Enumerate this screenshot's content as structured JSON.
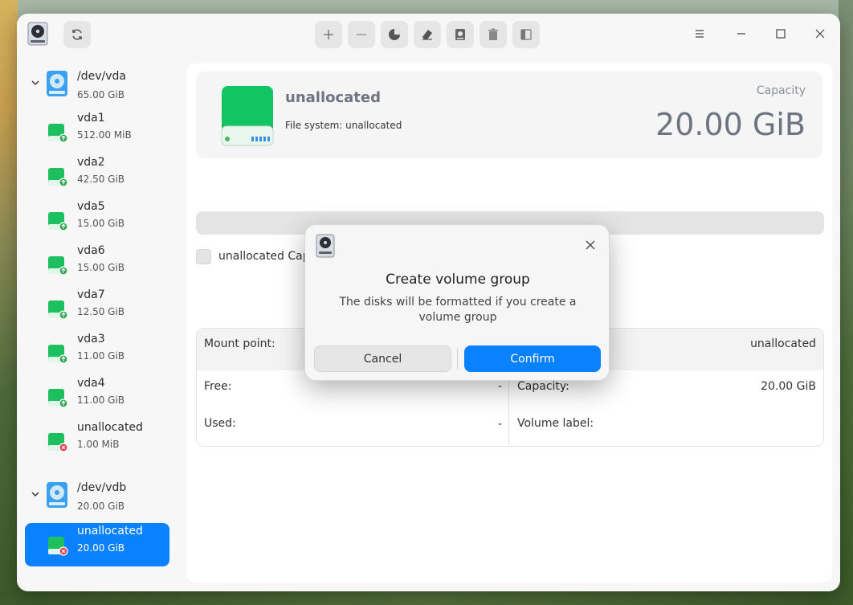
{
  "toolbar": {
    "refresh": "refresh-icon",
    "buttons": [
      "plus-icon",
      "minus-icon",
      "pie-chart-icon",
      "eraser-icon",
      "disk-info-icon",
      "delete-icon",
      "split-icon"
    ]
  },
  "sidebar": {
    "devices": [
      {
        "name": "/dev/vda",
        "size": "65.00 GiB",
        "partitions": [
          {
            "name": "vda1",
            "size": "512.00 MiB",
            "status": "mounted"
          },
          {
            "name": "vda2",
            "size": "42.50 GiB",
            "status": "mounted"
          },
          {
            "name": "vda5",
            "size": "15.00 GiB",
            "status": "mounted"
          },
          {
            "name": "vda6",
            "size": "15.00 GiB",
            "status": "mounted"
          },
          {
            "name": "vda7",
            "size": "12.50 GiB",
            "status": "mounted"
          },
          {
            "name": "vda3",
            "size": "11.00 GiB",
            "status": "mounted"
          },
          {
            "name": "vda4",
            "size": "11.00 GiB",
            "status": "mounted"
          },
          {
            "name": "unallocated",
            "size": "1.00 MiB",
            "status": "unallocated"
          }
        ]
      },
      {
        "name": "/dev/vdb",
        "size": "20.00 GiB",
        "partitions": [
          {
            "name": "unallocated",
            "size": "20.00 GiB",
            "status": "unallocated",
            "selected": true
          }
        ]
      }
    ]
  },
  "detail": {
    "title": "unallocated",
    "filesystem": "File system: unallocated",
    "capacity_label": "Capacity",
    "capacity_value": "20.00 GiB",
    "legend": "unallocated Capa",
    "props": {
      "mount_point_label": "Mount point:",
      "mount_point_value": "unallocated",
      "free_label": "Free:",
      "free_value": "-",
      "capacity_label": "Capacity:",
      "capacity_value": "20.00 GiB",
      "used_label": "Used:",
      "used_value": "-",
      "volume_label_label": "Volume label:",
      "volume_label_value": ""
    }
  },
  "dialog": {
    "title": "Create volume group",
    "message": "The disks will be formatted if you create a volume group",
    "cancel": "Cancel",
    "confirm": "Confirm"
  },
  "colors": {
    "accent": "#0a81ff",
    "disk_green": "#1dbf5e",
    "status_ok": "#2fa84f",
    "status_error": "#e5434b"
  }
}
